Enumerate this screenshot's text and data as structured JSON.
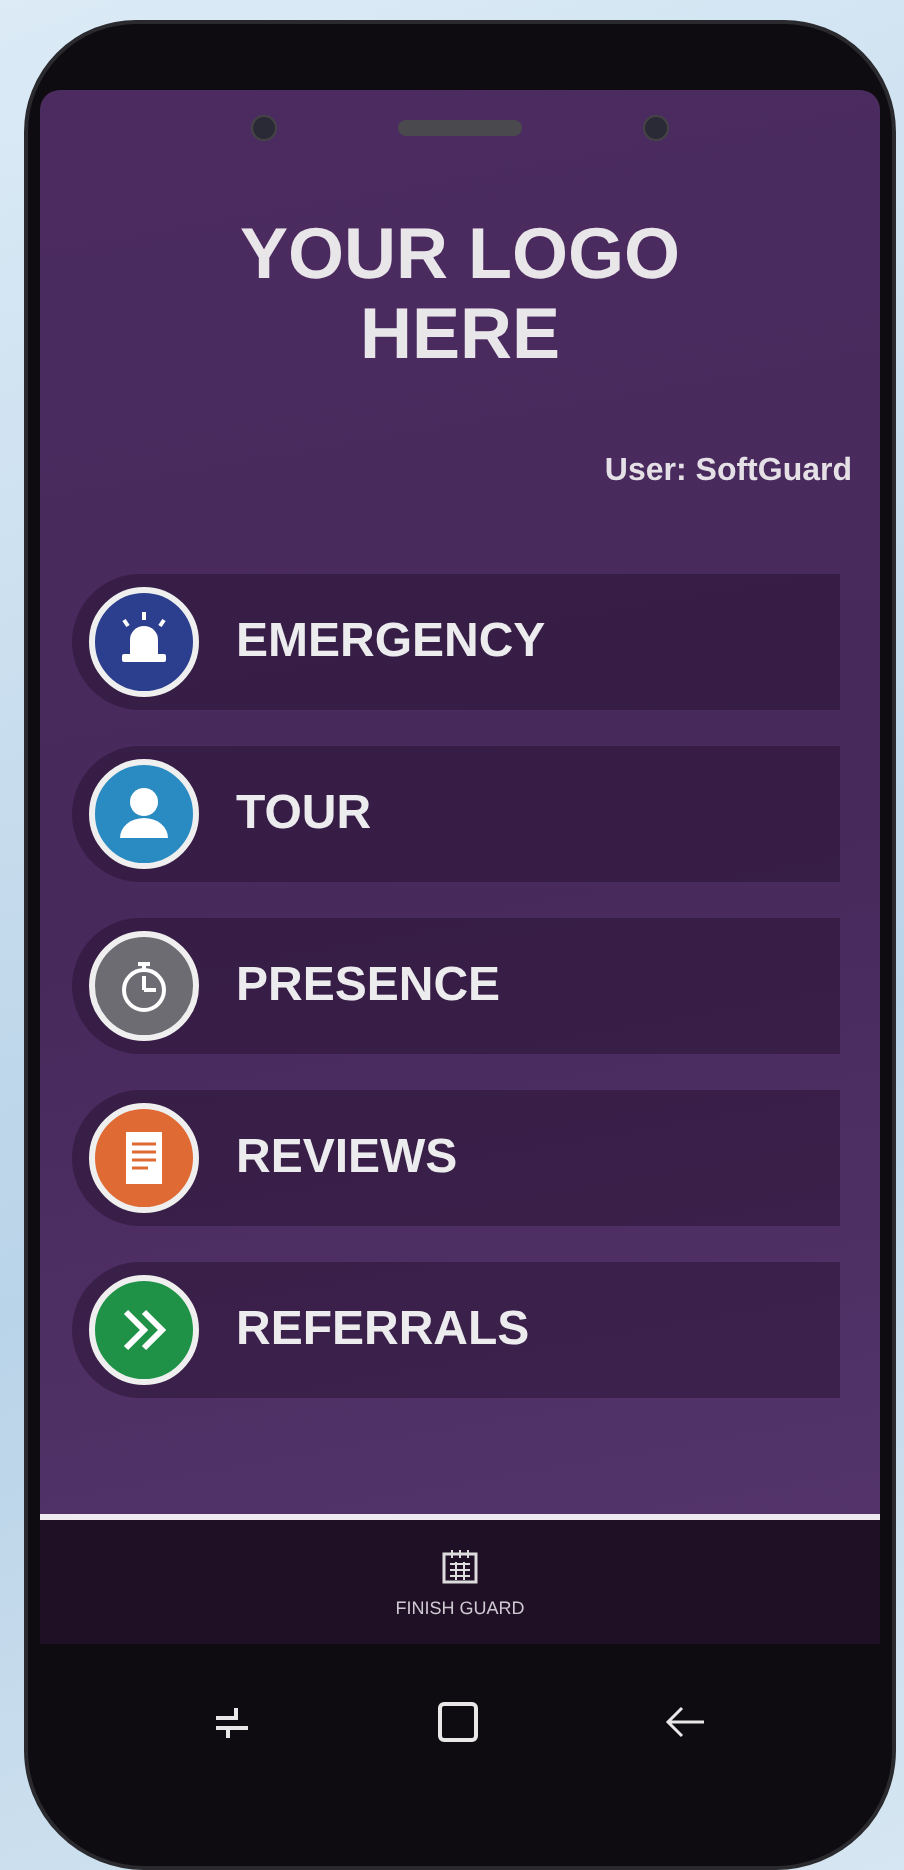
{
  "logo": {
    "text": "YOUR LOGO HERE"
  },
  "user": "User: SoftGuard",
  "menu": [
    {
      "label": "EMERGENCY",
      "kind": "beacon",
      "color": "#2b3f8e"
    },
    {
      "label": "TOUR",
      "kind": "person",
      "color": "#2a8bc2"
    },
    {
      "label": "PRESENCE",
      "kind": "stopwatch",
      "color": "#6d6c72"
    },
    {
      "label": "REVIEWS",
      "kind": "document",
      "color": "#df6a33"
    },
    {
      "label": "REFERRALS",
      "kind": "chevrons",
      "color": "#1f9247"
    }
  ],
  "footer_button": {
    "label": "FINISH GUARD"
  },
  "nav_buttons": [
    {
      "kind": "recent"
    },
    {
      "kind": "home"
    },
    {
      "kind": "back"
    }
  ]
}
